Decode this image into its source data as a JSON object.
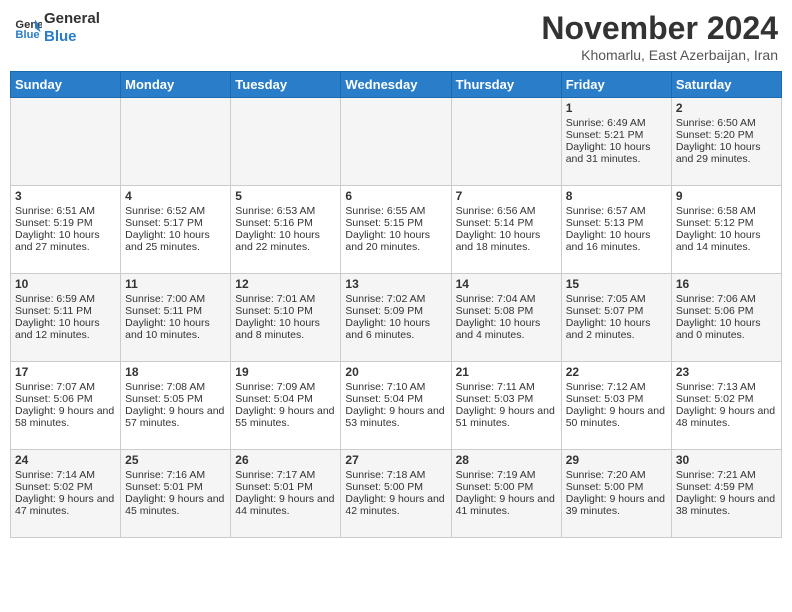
{
  "header": {
    "logo_line1": "General",
    "logo_line2": "Blue",
    "month_title": "November 2024",
    "location": "Khomarlu, East Azerbaijan, Iran"
  },
  "days_of_week": [
    "Sunday",
    "Monday",
    "Tuesday",
    "Wednesday",
    "Thursday",
    "Friday",
    "Saturday"
  ],
  "weeks": [
    [
      {
        "day": null,
        "info": null
      },
      {
        "day": null,
        "info": null
      },
      {
        "day": null,
        "info": null
      },
      {
        "day": null,
        "info": null
      },
      {
        "day": null,
        "info": null
      },
      {
        "day": "1",
        "info": "Sunrise: 6:49 AM\nSunset: 5:21 PM\nDaylight: 10 hours and 31 minutes."
      },
      {
        "day": "2",
        "info": "Sunrise: 6:50 AM\nSunset: 5:20 PM\nDaylight: 10 hours and 29 minutes."
      }
    ],
    [
      {
        "day": "3",
        "info": "Sunrise: 6:51 AM\nSunset: 5:19 PM\nDaylight: 10 hours and 27 minutes."
      },
      {
        "day": "4",
        "info": "Sunrise: 6:52 AM\nSunset: 5:17 PM\nDaylight: 10 hours and 25 minutes."
      },
      {
        "day": "5",
        "info": "Sunrise: 6:53 AM\nSunset: 5:16 PM\nDaylight: 10 hours and 22 minutes."
      },
      {
        "day": "6",
        "info": "Sunrise: 6:55 AM\nSunset: 5:15 PM\nDaylight: 10 hours and 20 minutes."
      },
      {
        "day": "7",
        "info": "Sunrise: 6:56 AM\nSunset: 5:14 PM\nDaylight: 10 hours and 18 minutes."
      },
      {
        "day": "8",
        "info": "Sunrise: 6:57 AM\nSunset: 5:13 PM\nDaylight: 10 hours and 16 minutes."
      },
      {
        "day": "9",
        "info": "Sunrise: 6:58 AM\nSunset: 5:12 PM\nDaylight: 10 hours and 14 minutes."
      }
    ],
    [
      {
        "day": "10",
        "info": "Sunrise: 6:59 AM\nSunset: 5:11 PM\nDaylight: 10 hours and 12 minutes."
      },
      {
        "day": "11",
        "info": "Sunrise: 7:00 AM\nSunset: 5:11 PM\nDaylight: 10 hours and 10 minutes."
      },
      {
        "day": "12",
        "info": "Sunrise: 7:01 AM\nSunset: 5:10 PM\nDaylight: 10 hours and 8 minutes."
      },
      {
        "day": "13",
        "info": "Sunrise: 7:02 AM\nSunset: 5:09 PM\nDaylight: 10 hours and 6 minutes."
      },
      {
        "day": "14",
        "info": "Sunrise: 7:04 AM\nSunset: 5:08 PM\nDaylight: 10 hours and 4 minutes."
      },
      {
        "day": "15",
        "info": "Sunrise: 7:05 AM\nSunset: 5:07 PM\nDaylight: 10 hours and 2 minutes."
      },
      {
        "day": "16",
        "info": "Sunrise: 7:06 AM\nSunset: 5:06 PM\nDaylight: 10 hours and 0 minutes."
      }
    ],
    [
      {
        "day": "17",
        "info": "Sunrise: 7:07 AM\nSunset: 5:06 PM\nDaylight: 9 hours and 58 minutes."
      },
      {
        "day": "18",
        "info": "Sunrise: 7:08 AM\nSunset: 5:05 PM\nDaylight: 9 hours and 57 minutes."
      },
      {
        "day": "19",
        "info": "Sunrise: 7:09 AM\nSunset: 5:04 PM\nDaylight: 9 hours and 55 minutes."
      },
      {
        "day": "20",
        "info": "Sunrise: 7:10 AM\nSunset: 5:04 PM\nDaylight: 9 hours and 53 minutes."
      },
      {
        "day": "21",
        "info": "Sunrise: 7:11 AM\nSunset: 5:03 PM\nDaylight: 9 hours and 51 minutes."
      },
      {
        "day": "22",
        "info": "Sunrise: 7:12 AM\nSunset: 5:03 PM\nDaylight: 9 hours and 50 minutes."
      },
      {
        "day": "23",
        "info": "Sunrise: 7:13 AM\nSunset: 5:02 PM\nDaylight: 9 hours and 48 minutes."
      }
    ],
    [
      {
        "day": "24",
        "info": "Sunrise: 7:14 AM\nSunset: 5:02 PM\nDaylight: 9 hours and 47 minutes."
      },
      {
        "day": "25",
        "info": "Sunrise: 7:16 AM\nSunset: 5:01 PM\nDaylight: 9 hours and 45 minutes."
      },
      {
        "day": "26",
        "info": "Sunrise: 7:17 AM\nSunset: 5:01 PM\nDaylight: 9 hours and 44 minutes."
      },
      {
        "day": "27",
        "info": "Sunrise: 7:18 AM\nSunset: 5:00 PM\nDaylight: 9 hours and 42 minutes."
      },
      {
        "day": "28",
        "info": "Sunrise: 7:19 AM\nSunset: 5:00 PM\nDaylight: 9 hours and 41 minutes."
      },
      {
        "day": "29",
        "info": "Sunrise: 7:20 AM\nSunset: 5:00 PM\nDaylight: 9 hours and 39 minutes."
      },
      {
        "day": "30",
        "info": "Sunrise: 7:21 AM\nSunset: 4:59 PM\nDaylight: 9 hours and 38 minutes."
      }
    ]
  ]
}
